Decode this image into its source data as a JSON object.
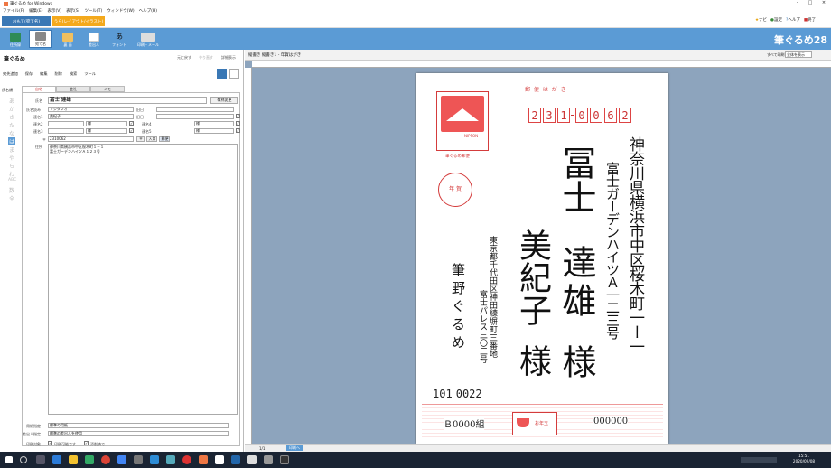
{
  "window": {
    "title": "筆ぐるめ for Windows"
  },
  "menu": [
    "ファイル(F)",
    "編集(E)",
    "表示(V)",
    "表示(S)",
    "ツール(T)",
    "ウィンドウ(W)",
    "ヘルプ(H)"
  ],
  "modes": {
    "beginner": "おもて(宛て名)",
    "inside": "うら(レイアウト/イラスト)"
  },
  "toolbar": [
    {
      "label": "住所録"
    },
    {
      "label": "宛て名"
    },
    {
      "label": "裏 面"
    },
    {
      "label": "差出人"
    },
    {
      "label": "フォント"
    },
    {
      "label": "印刷・メール"
    }
  ],
  "topright": {
    "navi": "ナビ",
    "settings": "設定",
    "help": "ヘルプ",
    "exit": "終了"
  },
  "brand": "筆ぐるめ28",
  "left": {
    "title": "筆ぐるめ",
    "top_actions": [
      "元に戻す",
      "やり直す",
      "詳細表示"
    ],
    "sub_toolbar": [
      "宛先追加",
      "保存",
      "編集",
      "削除",
      "検索",
      "ツール"
    ],
    "sort": "氏名順",
    "tabs": [
      "自宅",
      "会社",
      "メモ"
    ],
    "kana": [
      "あ",
      "か",
      "さ",
      "た",
      "な",
      "は",
      "ま",
      "や",
      "ら",
      "わ",
      "ABC",
      "数",
      "全"
    ],
    "fields": {
      "name_label": "氏名",
      "name_value": "冨士 達雄",
      "honorific_btn": "敬称変更",
      "furigana_label": "氏名読み",
      "furigana_value": "フジタツオ",
      "joint1_label": "連名1",
      "joint1_value": "美紀子",
      "joint2_label": "連名2",
      "joint3_label": "連名3",
      "honor": "様",
      "postal_label": "〒",
      "postal_value": "2310062",
      "postal_btns": [
        "〒",
        "入口",
        "郵便"
      ],
      "address_label": "住所",
      "address_line1": "神奈川県横浜市中区桜木町１－１",
      "address_line2": "富士ガーデンハイツＡ１２３号",
      "date_labels": [
        "旧日",
        "旧日",
        "連名4",
        "連名5"
      ]
    },
    "bottom_fields": [
      {
        "label": "用紙指定",
        "value": "標準の用紙"
      },
      {
        "label": "差出人指定",
        "value": "標準の差出人を使用"
      }
    ],
    "bottom_checks": [
      "印刷対象",
      "印刷可能です",
      "添削済で"
    ]
  },
  "right": {
    "header": "縦書き 縦書き1 - 年賀はがき",
    "zoom_label": "すべて印刷",
    "zoom_value": "全体を表示",
    "page": "1/1",
    "page_btn": "印刷へ"
  },
  "card": {
    "postcard_label": "郵 便 は が き",
    "zip": [
      "2",
      "3",
      "1",
      "0",
      "0",
      "6",
      "2"
    ],
    "stamp_text": "NIPPON",
    "stamp_caption": "筆ぐるめ郵便",
    "nenga": "年 賀",
    "addr1": "神奈川県横浜市中区桜木町一ー一",
    "addr2": "富士ガーデンハイツＡ一二三号",
    "name_surname": "冨士",
    "name_given": "達雄",
    "name_honor": "様",
    "joint_name": "美紀子",
    "joint_honor": "様",
    "sender_addr1": "東京都千代田区神田練塀町三番地",
    "sender_addr2": "富士パレス三〇三号",
    "sender_name": "筆野ぐるめ",
    "sender_zip": [
      "1",
      "0",
      "1",
      "0",
      "0",
      "2",
      "2"
    ],
    "lottery_group": "Ｂ0000組",
    "lottery_no": "000000",
    "otoshidama": "お年玉"
  },
  "taskbar": {
    "time": "15:51",
    "date": "2020/09/08"
  },
  "colors": {
    "accent": "#5b9bd5",
    "red": "#d43c3c",
    "orange": "#f4a91c"
  }
}
